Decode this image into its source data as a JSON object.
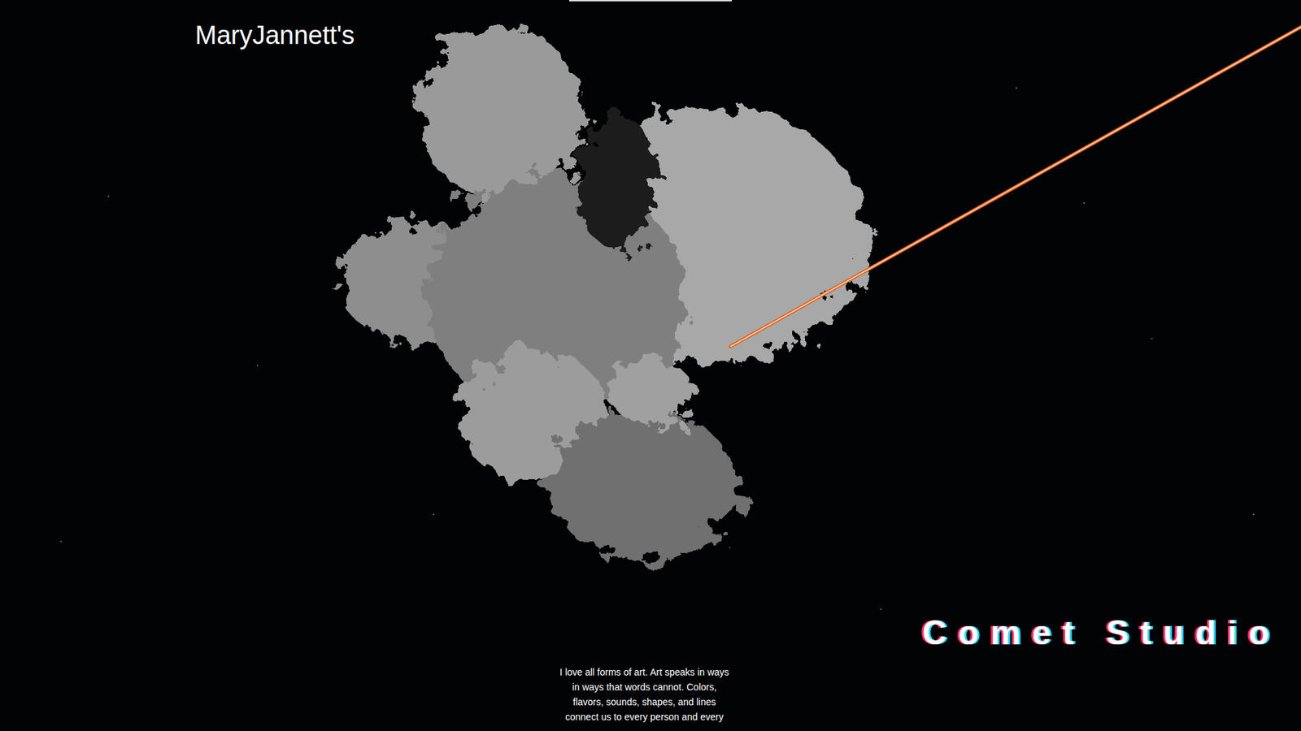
{
  "header": {
    "title": "MaryJannett's"
  },
  "hero": {
    "brand": "Comet Studio",
    "intro": "I love all forms of art. Art speaks in ways in ways that words cannot. Colors, flavors, sounds, shapes, and lines connect us to every person and every"
  }
}
